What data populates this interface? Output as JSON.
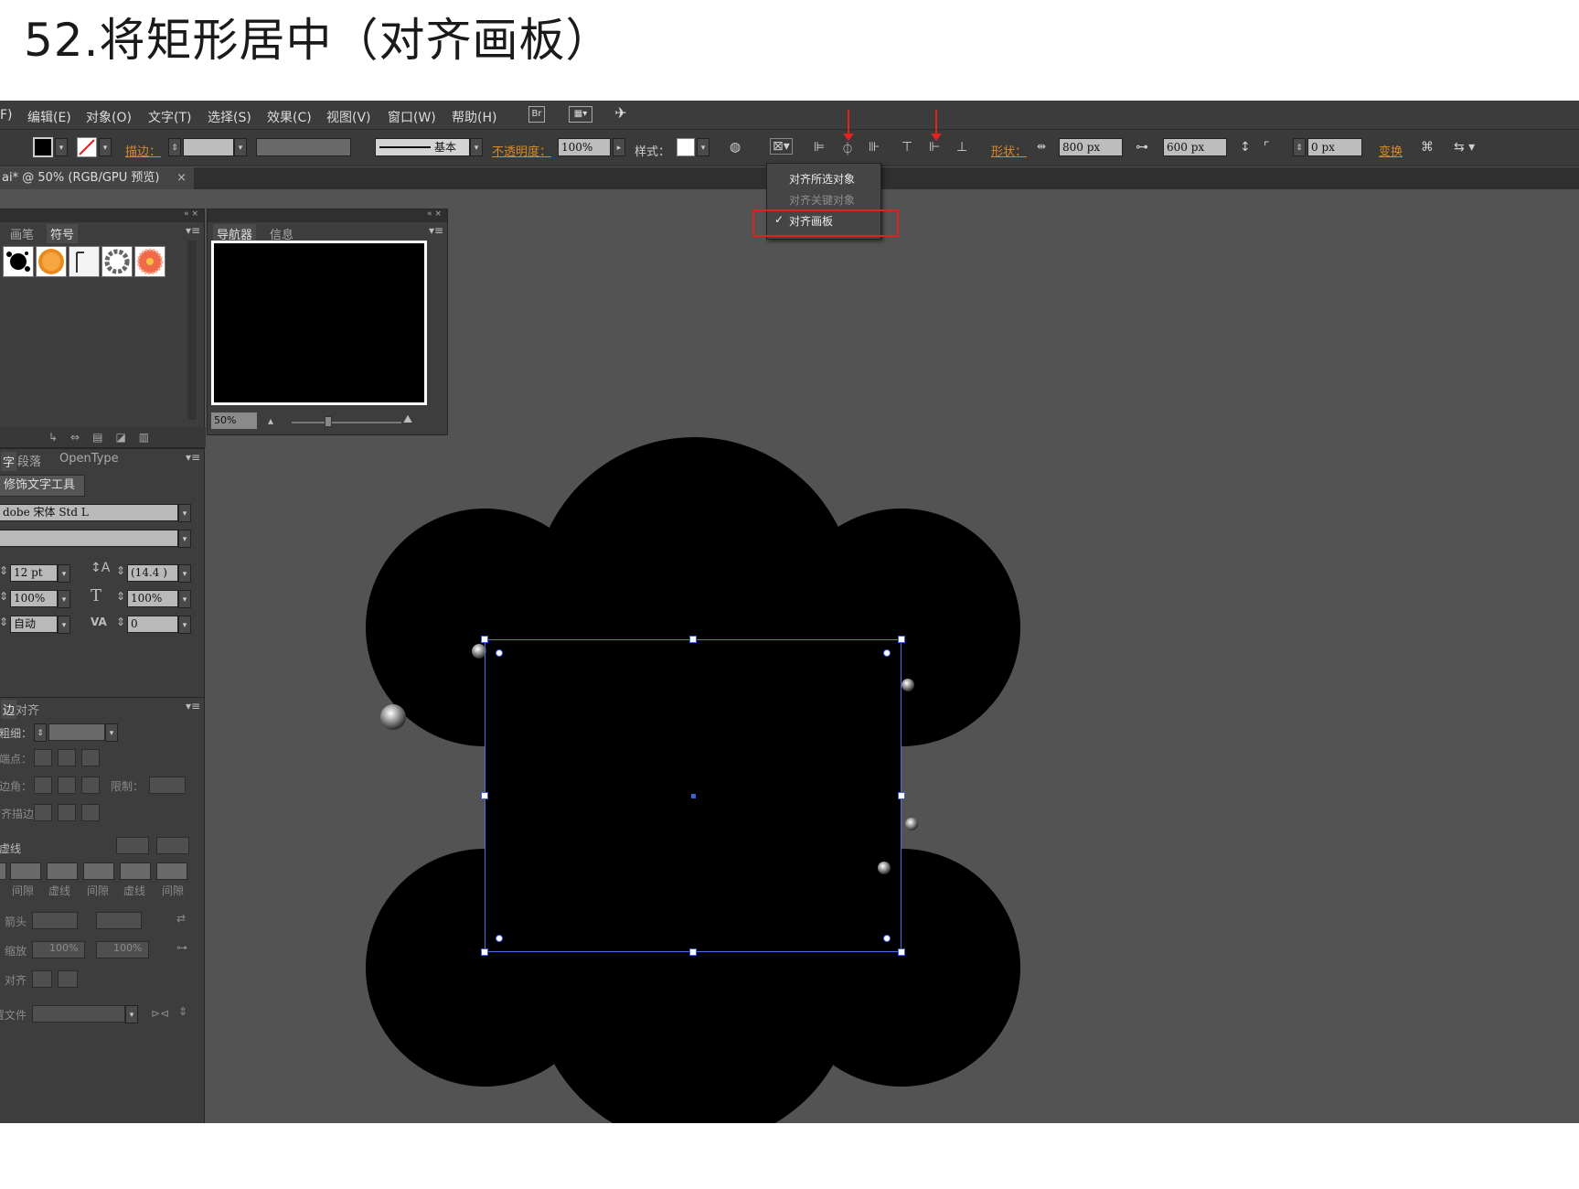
{
  "heading": "52.将矩形居中（对齐画板）",
  "menubar": {
    "items": [
      "F)",
      "编辑(E)",
      "对象(O)",
      "文字(T)",
      "选择(S)",
      "效果(C)",
      "视图(V)",
      "窗口(W)",
      "帮助(H)"
    ],
    "br_icon": "Br"
  },
  "control_bar": {
    "stroke_label": "描边：",
    "line_style": "基本",
    "opacity_label": "不透明度：",
    "opacity_value": "100%",
    "style_label": "样式：",
    "shape_label": "形状：",
    "width_value": "800 px",
    "height_value": "600 px",
    "corner_value": "0 px",
    "transform_label": "变换"
  },
  "document_tab": {
    "title": "ai* @ 50% (RGB/GPU 预览)",
    "close": "×"
  },
  "align_menu": {
    "items": [
      {
        "label": "对齐所选对象",
        "enabled": true
      },
      {
        "label": "对齐关键对象",
        "enabled": false
      },
      {
        "label": "对齐画板",
        "enabled": true,
        "checked": true
      }
    ],
    "check_mark": "✓"
  },
  "brush_panel": {
    "tabs": [
      "画笔",
      "符号"
    ]
  },
  "navigator_panel": {
    "tabs": [
      "导航器",
      "信息"
    ],
    "zoom": "50%"
  },
  "character_panel": {
    "tabs": [
      "段落",
      "OpenType"
    ],
    "touch_tool": "修饰文字工具",
    "font": "dobe 宋体 Std L",
    "size": "12 pt",
    "leading": "(14.4 )",
    "h_scale": "100%",
    "v_scale": "100%",
    "kerning": "自动",
    "tracking": "0"
  },
  "stroke_panel": {
    "tab": "对齐",
    "weight_label": "粗细：",
    "cap_label": "端点：",
    "corner_label": "边角：",
    "limit_label": "限制：",
    "align_label": "对齐描边：",
    "dashed_label": "虚线",
    "dash_labels": [
      "间隙",
      "虚线",
      "间隙",
      "虚线",
      "间隙"
    ],
    "arrow_label": "箭头：",
    "scale_label": "缩放：",
    "scale_values": [
      "100%",
      "100%"
    ],
    "align2_label": "对齐：",
    "profile_label": "配置文件："
  }
}
